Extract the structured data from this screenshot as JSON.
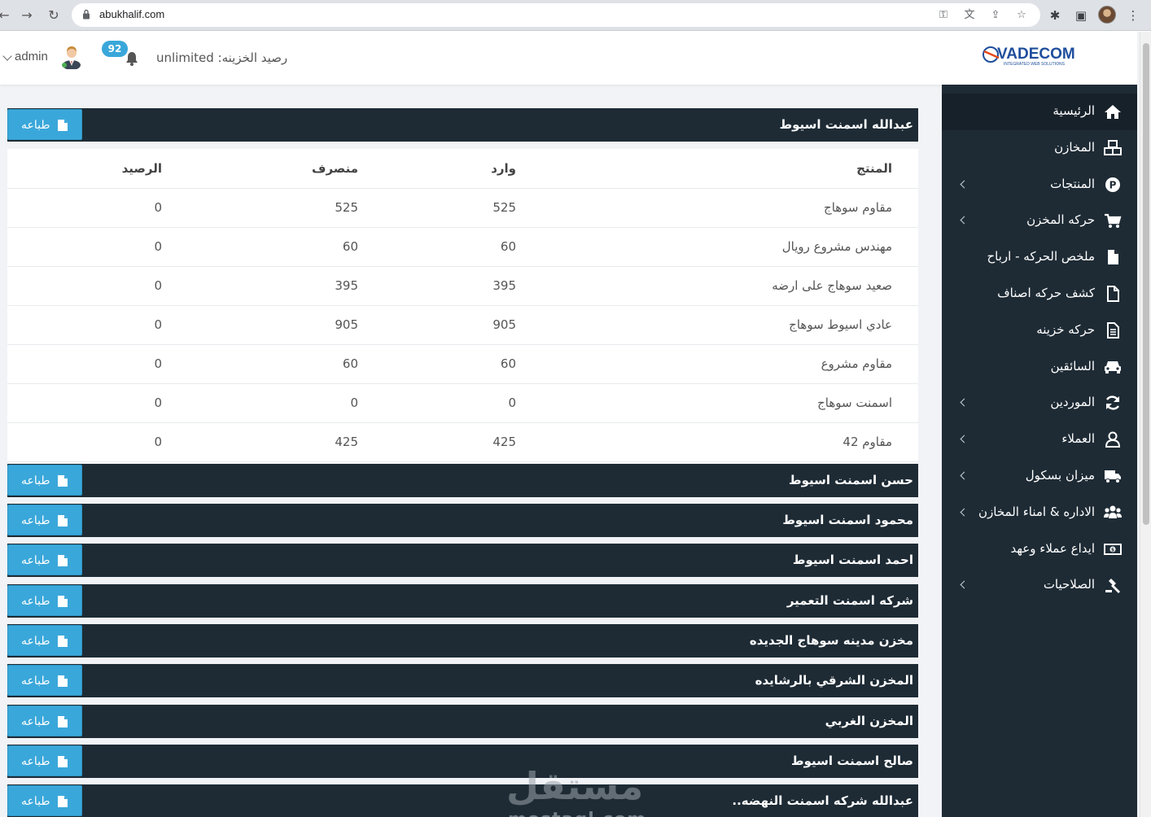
{
  "browser": {
    "url": "abukhalif.com"
  },
  "header": {
    "user_name": "admin",
    "notification_count": "92",
    "treasury_balance": "رصيد الخزينه: unlimited"
  },
  "brand": {
    "logo_text": "VADECOM",
    "logo_tagline": "INTEGRATED WEB SOLUTIONS"
  },
  "sidebar": {
    "items": [
      {
        "label": "الرئيسية",
        "icon": "home-icon",
        "has_arrow": false,
        "active": true
      },
      {
        "label": "المخازن",
        "icon": "boxes-icon",
        "has_arrow": false
      },
      {
        "label": "المنتجات",
        "icon": "product-icon",
        "has_arrow": true
      },
      {
        "label": "حركه المخزن",
        "icon": "cart-icon",
        "has_arrow": true
      },
      {
        "label": "ملخص الحركه - ارباح",
        "icon": "file-icon",
        "has_arrow": false
      },
      {
        "label": "كشف حركه اصناف",
        "icon": "file-outline-icon",
        "has_arrow": false
      },
      {
        "label": "حركه خزينه",
        "icon": "file-text-icon",
        "has_arrow": false
      },
      {
        "label": "السائقين",
        "icon": "car-icon",
        "has_arrow": false
      },
      {
        "label": "الموردين",
        "icon": "refresh-icon",
        "has_arrow": true
      },
      {
        "label": "العملاء",
        "icon": "user-icon",
        "has_arrow": true
      },
      {
        "label": "ميزان بسكول",
        "icon": "truck-icon",
        "has_arrow": true
      },
      {
        "label": "الاداره & امناء المخازن",
        "icon": "users-icon",
        "has_arrow": true
      },
      {
        "label": "ايداع عملاء وعهد",
        "icon": "money-icon",
        "has_arrow": false
      },
      {
        "label": "الصلاحيات",
        "icon": "gavel-icon",
        "has_arrow": true
      }
    ]
  },
  "content": {
    "print_label": "طباعه",
    "table": {
      "headers": {
        "product": "المنتج",
        "in": "وارد",
        "out": "منصرف",
        "balance": "الرصيد"
      },
      "rows": [
        {
          "product": "مقاوم سوهاج",
          "in": "525",
          "out": "525",
          "balance": "0"
        },
        {
          "product": "مهندس مشروع رويال",
          "in": "60",
          "out": "60",
          "balance": "0"
        },
        {
          "product": "صعيد سوهاج على ارضه",
          "in": "395",
          "out": "395",
          "balance": "0"
        },
        {
          "product": "عادي اسيوط سوهاج",
          "in": "905",
          "out": "905",
          "balance": "0"
        },
        {
          "product": "مقاوم مشروع",
          "in": "60",
          "out": "60",
          "balance": "0"
        },
        {
          "product": "اسمنت سوهاج",
          "in": "0",
          "out": "0",
          "balance": "0"
        },
        {
          "product": "مقاوم 42",
          "in": "425",
          "out": "425",
          "balance": "0"
        }
      ]
    },
    "warehouses": [
      "عبدالله اسمنت اسيوط",
      "حسن اسمنت اسيوط",
      "محمود اسمنت اسيوط",
      "احمد اسمنت اسيوط",
      "شركه اسمنت التعمير",
      "مخزن مدينه سوهاج الجديده",
      "المخزن الشرقي بالرشايده",
      "المخزن الغربي",
      "صالح اسمنت اسيوط",
      "عبدالله شركه اسمنت النهضه.."
    ]
  },
  "watermark": {
    "arabic": "مستقل",
    "latin": "mostaql.com"
  }
}
